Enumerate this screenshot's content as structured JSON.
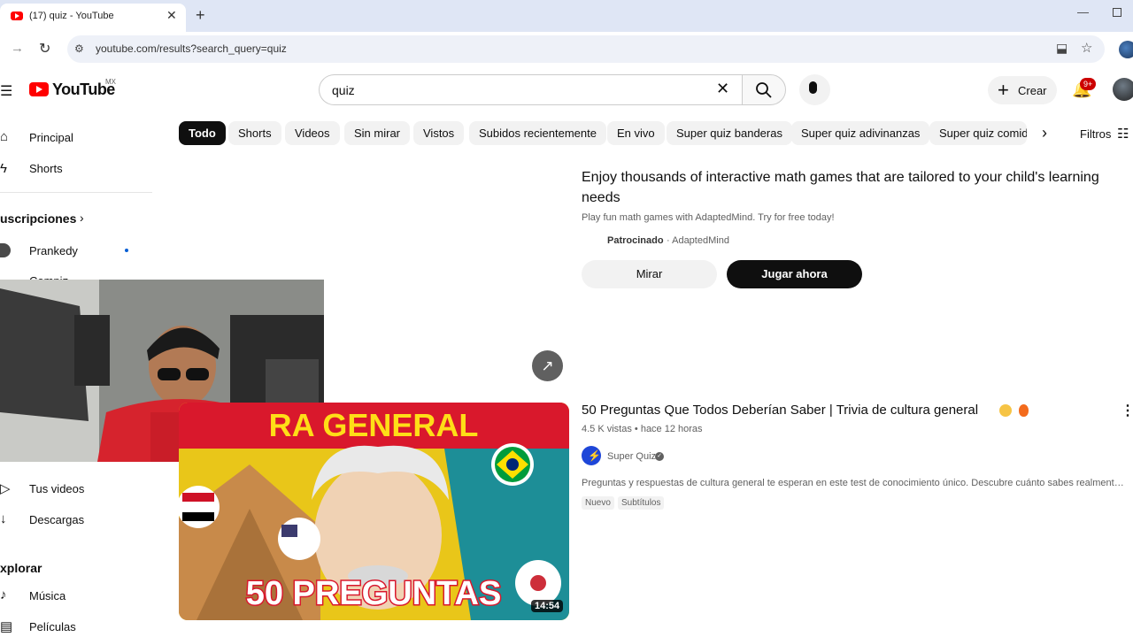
{
  "browser": {
    "tab_title": "(17) quiz - YouTube",
    "url": "youtube.com/results?search_query=quiz",
    "new_tab_glyph": "+",
    "close_glyph": "✕"
  },
  "header": {
    "logo_text": "YouTube",
    "country_code": "MX",
    "search_query": "quiz",
    "create_label": "Crear",
    "notifications_badge": "9+"
  },
  "chips": [
    "Todo",
    "Shorts",
    "Videos",
    "Sin mirar",
    "Vistos",
    "Subidos recientemente",
    "En vivo",
    "Super quiz banderas",
    "Super quiz adivinanzas",
    "Super quiz comida"
  ],
  "filters_label": "Filtros",
  "sidebar": {
    "items_top": [
      {
        "label": "Principal",
        "icon": "home-icon"
      },
      {
        "label": "Shorts",
        "icon": "shorts-icon"
      }
    ],
    "subscriptions_heading": "uscripciones",
    "subscription_items": [
      {
        "label": "Prankedy"
      }
    ],
    "cut_item": "Compiz",
    "items_you": [
      {
        "label": "Tus videos",
        "icon": "video-icon"
      },
      {
        "label": "Descargas",
        "icon": "download-icon"
      }
    ],
    "explore_heading": "xplorar",
    "explore_items": [
      {
        "label": "Música",
        "icon": "music-icon"
      },
      {
        "label": "Películas",
        "icon": "film-icon"
      }
    ]
  },
  "ad": {
    "title": "Enjoy thousands of interactive math games that are tailored to your child's learning needs",
    "description": "Play fun math games with AdaptedMind. Try for free today!",
    "sponsored_label": "Patrocinado",
    "advertiser": "· AdaptedMind",
    "watch_label": "Mirar",
    "play_label": "Jugar ahora"
  },
  "video": {
    "title": "50 Preguntas Que Todos Deberían Saber | Trivia de cultura general",
    "meta": "4.5 K vistas • hace 12 horas",
    "channel": "Super Quiz",
    "description": "Preguntas y respuestas de cultura general te esperan en este test de conocimiento único. Descubre cuánto sabes realmente con ...",
    "badges": [
      "Nuevo",
      "Subtítulos"
    ],
    "duration": "14:54",
    "thumb_top_text": "RA GENERAL",
    "thumb_bottom_text": "50 PREGUNTAS"
  },
  "colors": {
    "youtube_red": "#ff0000",
    "chip_active": "#0f0f0f",
    "thumb_yellow": "#e9c619",
    "thumb_red": "#d9182c",
    "thumb_teal": "#1d8e97"
  }
}
